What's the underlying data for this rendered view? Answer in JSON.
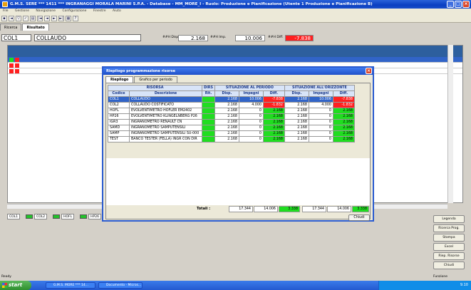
{
  "window": {
    "title": "G.M.S. SERE *** 1411 *** INGRANAGGI MORALA MARINI S.P.A. - Database - MM_MORE_I - Ruolo: Produzione e Pianificazione (Utente 1 Produzione e Pianificazione  B)"
  },
  "menubar": {
    "items": [
      "File",
      "Gestione",
      "Navigazione",
      "Configurazione",
      "Finestre",
      "Aiuto"
    ]
  },
  "toolbar": {
    "icons": [
      "save-icon",
      "back-icon",
      "filter-icon",
      "check-icon",
      "print-icon",
      "first-icon",
      "prev-icon",
      "next-icon",
      "last-icon",
      "grid-icon",
      "help-icon"
    ]
  },
  "tabs": [
    "Ricerca",
    "Risultato"
  ],
  "header": {
    "code": "COL1",
    "name": "COLLAUDO",
    "disp_label": "##H Disp.",
    "disp_value": "2.168",
    "imp_label": "##H Imp.",
    "imp_value": "10.006",
    "diff_label": "##H Diff.",
    "diff_value": "-7.838"
  },
  "legend": [
    {
      "code": "COL1"
    },
    {
      "code": "COL2"
    },
    {
      "code": "HOFL"
    },
    {
      "code": "HP26"
    }
  ],
  "right_buttons": [
    "Legenda",
    "Ricerca Prog.",
    "Stampa",
    "Excel",
    "Riep. Risorse",
    "Chiudi"
  ],
  "status": {
    "left": "Ready",
    "right": "Funzione"
  },
  "taskbar": {
    "start": "start",
    "tasks": [
      "G.M.S. MORE *** 14...",
      "Documento - Micros..."
    ],
    "clock": "9.10"
  },
  "dialog": {
    "title": "Riepilogo programmazione risorse",
    "tabs": [
      "Riepilogo",
      "Grafico per periodo"
    ],
    "group_headers": {
      "risorsa": "RISORSA",
      "dirs": "DIRS",
      "periodo": "SITUAZIONE AL PERIODO",
      "orizzonte": "SITUAZIONE ALL'ORIZZONTE"
    },
    "columns": [
      "Codice",
      "Descrizione",
      "Rit.",
      "Disp.",
      "Impegni",
      "Diff.",
      "Disp.",
      "Impegni",
      "Diff."
    ],
    "rows": [
      {
        "code": "COL1",
        "desc": "COLLAUDO",
        "disp": "2.168",
        "imp": "10.006",
        "diff": "-7.838",
        "disp2": "2.168",
        "imp2": "10.006",
        "diff2": "-7.838",
        "state": "red"
      },
      {
        "code": "COL2",
        "desc": "COLLAUDO COSTIFICATO",
        "disp": "2.168",
        "imp": "4.000",
        "diff": "-1.832",
        "disp2": "2.168",
        "imp2": "4.000",
        "diff2": "-1.832",
        "state": "red"
      },
      {
        "code": "HOFL",
        "desc": "EVOLVENTIMETRO HOFLER EM2402",
        "disp": "2.168",
        "imp": "0",
        "diff": "2.168",
        "disp2": "2.168",
        "imp2": "0",
        "diff2": "2.168",
        "state": "green"
      },
      {
        "code": "HP26",
        "desc": "EVOLVENTIMETRO KLINGELNBERG P26",
        "disp": "2.168",
        "imp": "0",
        "diff": "2.168",
        "disp2": "2.168",
        "imp2": "0",
        "diff2": "2.168",
        "state": "green"
      },
      {
        "code": "IGR3",
        "desc": "INGRANOMETRO RENAULT CN",
        "disp": "2.168",
        "imp": "0",
        "diff": "2.168",
        "disp2": "2.168",
        "imp2": "0",
        "diff2": "2.168",
        "state": "green"
      },
      {
        "code": "SAMD",
        "desc": "INGRANOMETRO SAMPUTENSILI",
        "disp": "2.168",
        "imp": "0",
        "diff": "2.168",
        "disp2": "2.168",
        "imp2": "0",
        "diff2": "2.168",
        "state": "green"
      },
      {
        "code": "SAMP",
        "desc": "INGRANOMETRO SAMPUTENSILI SU-000",
        "disp": "2.168",
        "imp": "0",
        "diff": "2.168",
        "disp2": "2.168",
        "imp2": "0",
        "diff2": "2.168",
        "state": "green"
      },
      {
        "code": "TEST",
        "desc": "BANCO TESTER (FELLA) INGR CON DIR",
        "disp": "2.168",
        "imp": "0",
        "diff": "2.168",
        "disp2": "2.168",
        "imp2": "0",
        "diff2": "2.168",
        "state": "green"
      }
    ],
    "totals_label": "Totali :",
    "totals": {
      "disp": "17.344",
      "imp": "14.006",
      "diff": "3.338",
      "disp2": "17.344",
      "imp2": "14.006",
      "diff2": "3.338"
    },
    "close_label": "Chiudi"
  },
  "colors": {
    "accent": "#2a5bd0",
    "ok": "#20dd20",
    "ko": "#ff2020"
  }
}
